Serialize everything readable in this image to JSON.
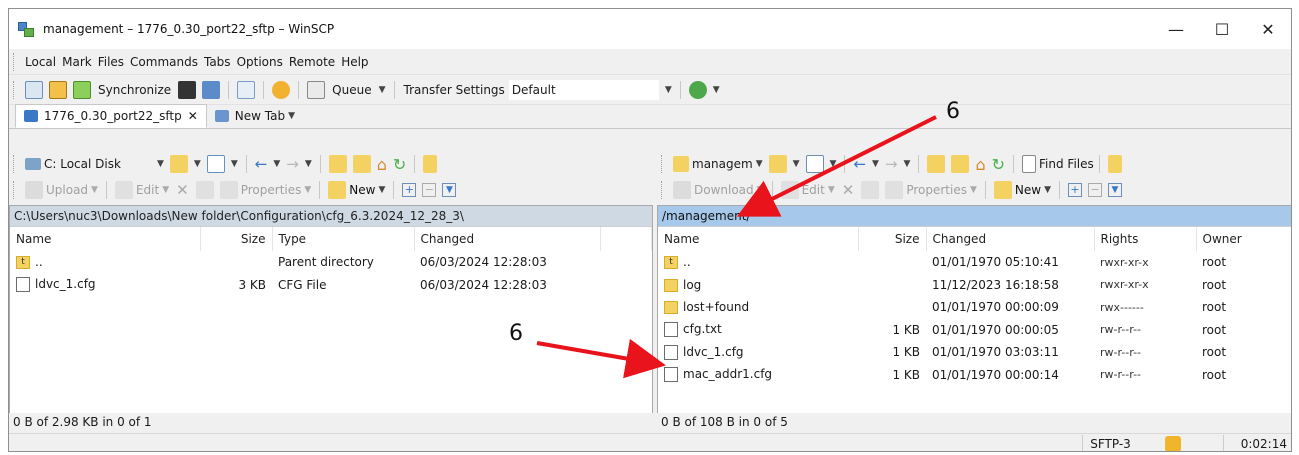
{
  "window": {
    "title": "management – 1776_0.30_port22_sftp – WinSCP",
    "minimize": "—",
    "maximize": "☐",
    "close": "✕"
  },
  "menu": [
    "Local",
    "Mark",
    "Files",
    "Commands",
    "Tabs",
    "Options",
    "Remote",
    "Help"
  ],
  "toolbar": {
    "synchronize": "Synchronize",
    "queue": "Queue",
    "transfer_settings": "Transfer Settings",
    "transfer_profile": "Default"
  },
  "tabs": [
    {
      "label": "1776_0.30_port22_sftp",
      "close": "✕"
    },
    {
      "label": "New Tab"
    }
  ],
  "left": {
    "drive": "C: Local Disk",
    "actions": {
      "upload": "Upload",
      "edit": "Edit",
      "properties": "Properties",
      "new": "New"
    },
    "path": "C:\\Users\\nuc3\\Downloads\\New folder\\Configuration\\cfg_6.3.2024_12_28_3\\",
    "columns": [
      "Name",
      "Size",
      "Type",
      "Changed"
    ],
    "rows": [
      {
        "icon": "parent-dir-icon",
        "name": "..",
        "size": "",
        "type": "Parent directory",
        "changed": "06/03/2024 12:28:03"
      },
      {
        "icon": "file-icon",
        "name": "ldvc_1.cfg",
        "size": "3 KB",
        "type": "CFG File",
        "changed": "06/03/2024 12:28:03"
      }
    ],
    "status": "0 B of 2.98 KB in 0 of 1"
  },
  "right": {
    "drive": "managem",
    "actions": {
      "download": "Download",
      "edit": "Edit",
      "properties": "Properties",
      "new": "New",
      "find_files": "Find Files"
    },
    "path": "/management/",
    "columns": [
      "Name",
      "Size",
      "Changed",
      "Rights",
      "Owner"
    ],
    "rows": [
      {
        "icon": "parent-dir-icon",
        "name": "..",
        "size": "",
        "changed": "01/01/1970 05:10:41",
        "rights": "rwxr-xr-x",
        "owner": "root"
      },
      {
        "icon": "folder-icon",
        "name": "log",
        "size": "",
        "changed": "11/12/2023 16:18:58",
        "rights": "rwxr-xr-x",
        "owner": "root"
      },
      {
        "icon": "folder-icon",
        "name": "lost+found",
        "size": "",
        "changed": "01/01/1970 00:00:09",
        "rights": "rwx------",
        "owner": "root"
      },
      {
        "icon": "file-icon",
        "name": "cfg.txt",
        "size": "1 KB",
        "changed": "01/01/1970 00:00:05",
        "rights": "rw-r--r--",
        "owner": "root"
      },
      {
        "icon": "file-icon",
        "name": "ldvc_1.cfg",
        "size": "1 KB",
        "changed": "01/01/1970 03:03:11",
        "rights": "rw-r--r--",
        "owner": "root"
      },
      {
        "icon": "file-icon",
        "name": "mac_addr1.cfg",
        "size": "1 KB",
        "changed": "01/01/1970 00:00:14",
        "rights": "rw-r--r--",
        "owner": "root"
      }
    ],
    "status": "0 B of 108 B in 0 of 5"
  },
  "statusbar": {
    "protocol": "SFTP-3",
    "elapsed": "0:02:14"
  },
  "annotations": [
    {
      "label": "6"
    },
    {
      "label": "6"
    }
  ],
  "colors": {
    "arrow": "#e8131b",
    "active_path": "#a6c8ea",
    "inactive_path": "#cfd9e3"
  }
}
